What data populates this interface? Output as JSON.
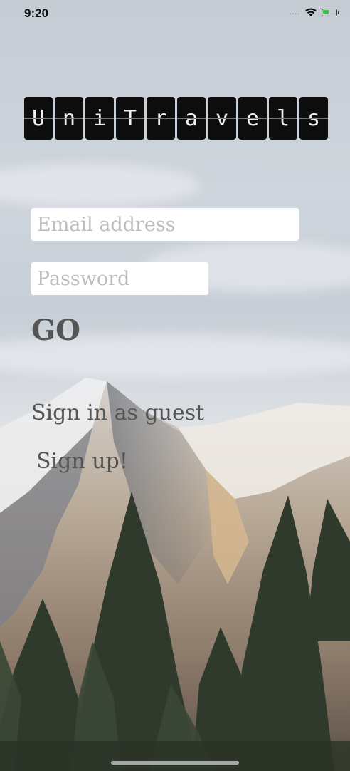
{
  "status_bar": {
    "time": "9:20",
    "signal": "....",
    "wifi_icon": "wifi-icon",
    "battery_icon": "battery-charging-icon"
  },
  "logo": {
    "letters": [
      "U",
      "n",
      "i",
      "T",
      "r",
      "a",
      "v",
      "e",
      "l",
      "s"
    ]
  },
  "login": {
    "email_placeholder": "Email address",
    "email_value": "",
    "password_placeholder": "Password",
    "password_value": "",
    "go_label": "GO",
    "guest_label": "Sign in as guest",
    "signup_label": "Sign up!"
  },
  "colors": {
    "logo_tile": "#0d0d0d",
    "logo_letter": "#f1f1f1",
    "link_text": "#555555",
    "input_bg": "#ffffff",
    "placeholder": "#bdbdbd"
  }
}
